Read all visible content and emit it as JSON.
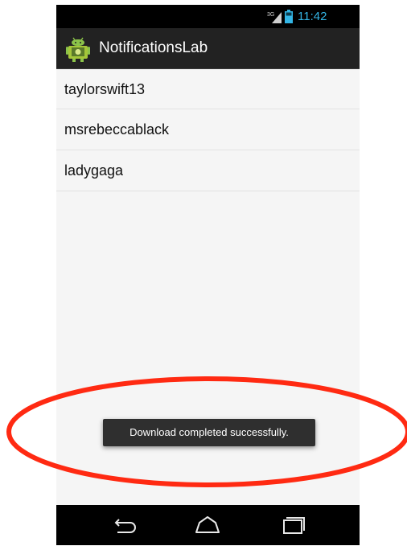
{
  "status_bar": {
    "network_label": "3G",
    "time": "11:42",
    "time_color": "#33b5e5"
  },
  "action_bar": {
    "app_title": "NotificationsLab",
    "icon": "android-app-icon"
  },
  "list": {
    "items": [
      {
        "label": "taylorswift13"
      },
      {
        "label": "msrebeccablack"
      },
      {
        "label": "ladygaga"
      }
    ]
  },
  "toast": {
    "message": "Download completed successfully."
  },
  "nav_bar": {
    "back_icon": "back-icon",
    "home_icon": "home-icon",
    "recent_icon": "recent-apps-icon"
  },
  "colors": {
    "annotation": "#ff2a12",
    "accent": "#33b5e5",
    "action_bar_bg": "#222222"
  }
}
